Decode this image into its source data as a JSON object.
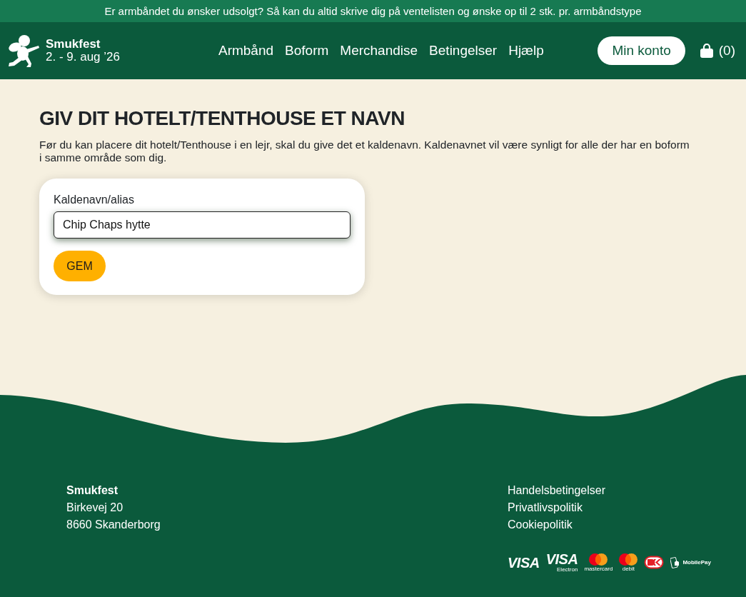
{
  "announcement": {
    "text": "Er armbåndet du ønsker udsolgt? Så kan du altid skrive dig på ventelisten og ønske op til 2 stk. pr. armbåndstype"
  },
  "header": {
    "logo": {
      "name": "Smukfest",
      "dates": "2. - 9. aug ’26"
    },
    "nav": [
      {
        "label": "Armbånd"
      },
      {
        "label": "Boform"
      },
      {
        "label": "Merchandise"
      },
      {
        "label": "Betingelser"
      },
      {
        "label": "Hjælp"
      }
    ],
    "account_button": {
      "label": "Min konto"
    },
    "cart": {
      "count": "(0)"
    }
  },
  "main": {
    "title": "GIV DIT HOTELT/TENTHOUSE ET NAVN",
    "intro": "Før du kan placere dit hotelt/Tenthouse i en lejr, skal du give det et kaldenavn. Kaldenavnet vil være synligt for alle der har en boform i samme område som dig.",
    "form": {
      "label": "Kaldenavn/alias",
      "field": {
        "value": "Chip Chaps hytte",
        "focused": true
      },
      "submit": {
        "label": "GEM"
      }
    }
  },
  "footer": {
    "address": [
      {
        "kind": "name",
        "text": "Smukfest"
      },
      {
        "kind": "line",
        "text": "Birkevej 20"
      },
      {
        "kind": "line",
        "text": "8660 Skanderborg"
      }
    ],
    "links": [
      {
        "label": "Handelsbetingelser"
      },
      {
        "label": "Privatlivspolitik"
      },
      {
        "label": "Cookiepolitik"
      }
    ],
    "payment_logos": [
      {
        "kind": "wordmark",
        "text": "VISA"
      },
      {
        "kind": "wordmark",
        "text": "VISA",
        "caption": "Electron"
      },
      {
        "kind": "circles",
        "caption": "mastercard"
      },
      {
        "kind": "circles",
        "caption": "debit"
      },
      {
        "kind": "oval"
      },
      {
        "kind": "phone",
        "text": "MobilePay"
      }
    ]
  }
}
